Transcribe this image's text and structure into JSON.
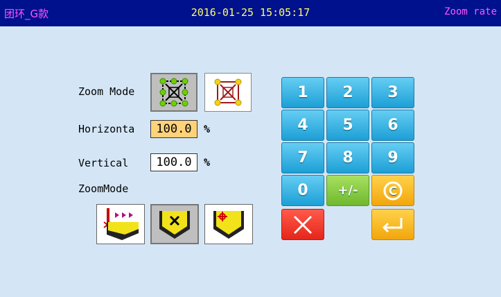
{
  "header": {
    "left_title": "团环_G款",
    "datetime": "2016-01-25 15:05:17",
    "right_title": "Zoom rate"
  },
  "form": {
    "zoom_mode_label": "Zoom Mode",
    "horizontal_label": "Horizonta",
    "horizontal_value": "100.0",
    "horizontal_unit": "%",
    "vertical_label": "Vertical",
    "vertical_value": "100.0",
    "vertical_unit": "%",
    "zoommode2_label": "ZoomMode"
  },
  "mode_buttons": [
    {
      "icon": "proportional-zoom-icon",
      "selected": true
    },
    {
      "icon": "free-zoom-icon",
      "selected": false
    }
  ],
  "zoom_buttons": [
    {
      "icon": "reference-point-side-icon",
      "selected": false
    },
    {
      "icon": "reference-point-center-icon",
      "selected": true
    },
    {
      "icon": "reference-point-origin-icon",
      "selected": false
    }
  ],
  "keypad": {
    "keys": [
      "1",
      "2",
      "3",
      "4",
      "5",
      "6",
      "7",
      "8",
      "9",
      "0",
      "+/-",
      "C"
    ],
    "cancel": "cancel-icon",
    "enter": "enter-icon"
  },
  "colors": {
    "titlebar": "#00118e",
    "title_left": "#ff55ff",
    "datetime": "#ffff66",
    "background": "#d4e6f6",
    "active_field": "#ffd27a"
  }
}
